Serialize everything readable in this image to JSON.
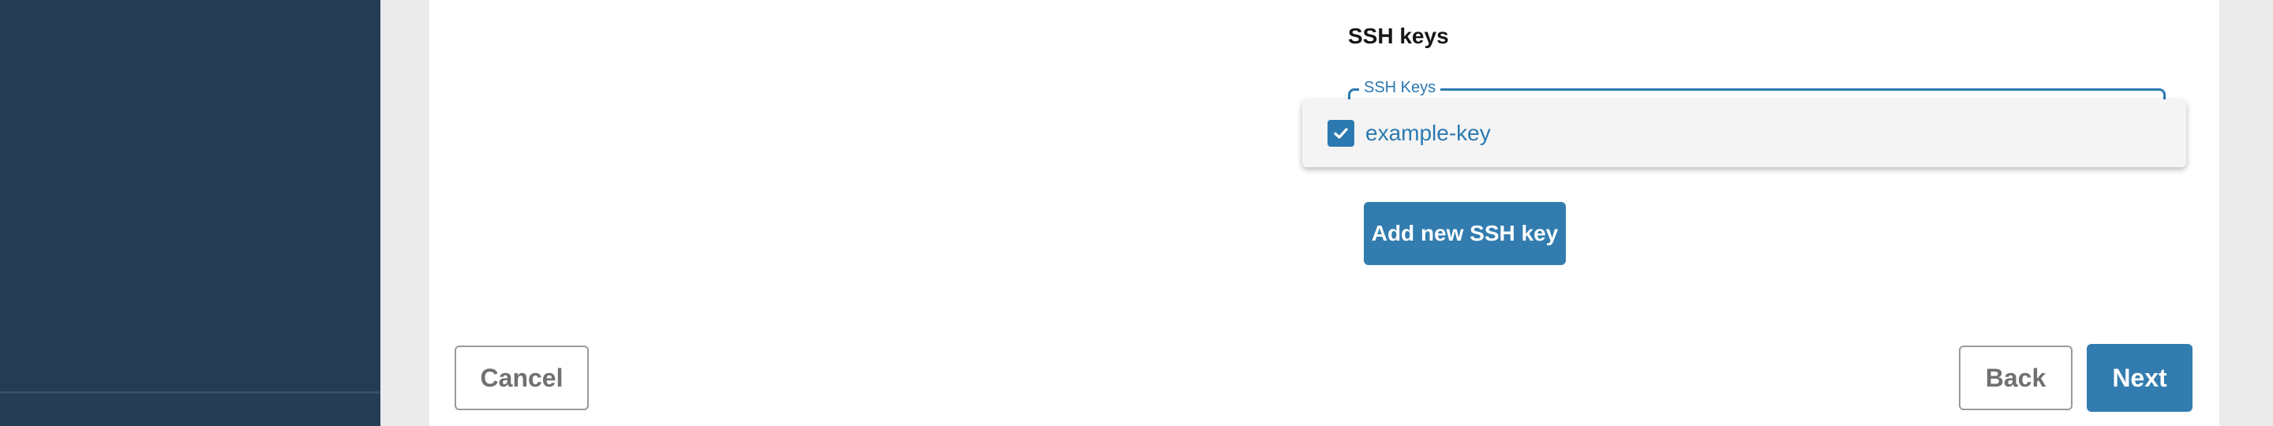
{
  "ssh_section": {
    "title": "SSH keys",
    "field_legend": "SSH Keys",
    "options": [
      {
        "label": "example-key",
        "checked": true
      }
    ],
    "add_button_label": "Add new SSH key"
  },
  "footer": {
    "cancel_label": "Cancel",
    "back_label": "Back",
    "next_label": "Next"
  },
  "colors": {
    "sidebar": "#263c55",
    "accent": "#327caf",
    "text_link": "#2b79b0"
  },
  "icons": {
    "checkbox": "checkmark-icon"
  }
}
